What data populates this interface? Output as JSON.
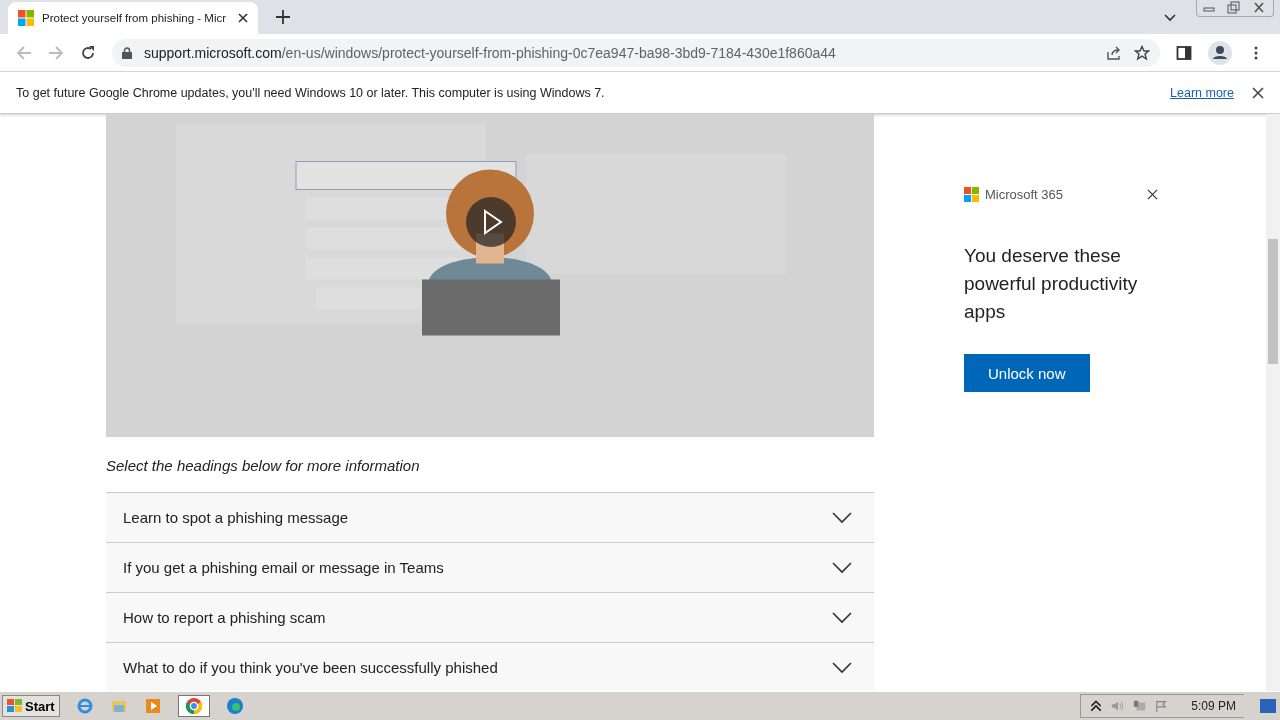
{
  "browser": {
    "tab": {
      "title": "Protect yourself from phishing - Micr",
      "selected": true
    },
    "url": {
      "host": "support.microsoft.com",
      "path": "/en-us/windows/protect-yourself-from-phishing-0c7ea947-ba98-3bd9-7184-430e1f860a44"
    },
    "infobar": {
      "message": "To get future Google Chrome updates, you'll need Windows 10 or later. This computer is using Windows 7.",
      "link": "Learn more"
    }
  },
  "article": {
    "instruction": "Select the headings below for more information",
    "sections": [
      {
        "title": "Learn to spot a phishing message",
        "expanded": false
      },
      {
        "title": "If you get a phishing email or message in Teams",
        "expanded": false
      },
      {
        "title": "How to report a phishing scam",
        "expanded": false
      },
      {
        "title": "What to do if you think you've been successfully phished",
        "expanded": false
      }
    ]
  },
  "ad": {
    "brand": "Microsoft 365",
    "headline": "You deserve these powerful productivity apps",
    "button": "Unlock now"
  },
  "taskbar": {
    "start": "Start",
    "clock": "5:09 PM"
  }
}
